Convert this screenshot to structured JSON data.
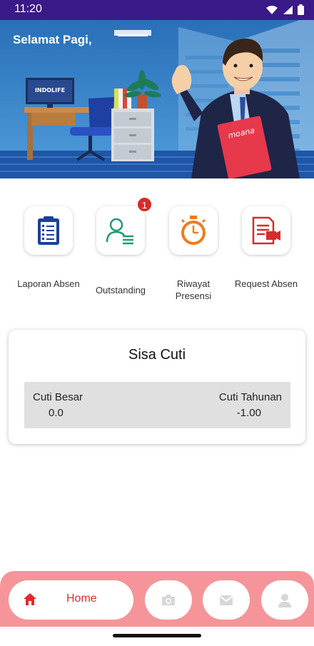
{
  "status_bar": {
    "time": "11:20"
  },
  "hero": {
    "greeting": "Selamat Pagi,",
    "monitor_logo": "INDOLIFE",
    "folder_logo": "moana"
  },
  "menu": {
    "items": [
      {
        "label": "Laporan Absen",
        "icon": "clipboard-checklist-icon",
        "color": "#1d3f9a"
      },
      {
        "label": "Outstanding",
        "icon": "user-list-icon",
        "color": "#1e9a7a",
        "badge": "1"
      },
      {
        "label": "Riwayat Presensi",
        "icon": "stopwatch-icon",
        "color": "#f07b1e"
      },
      {
        "label": "Request Absen",
        "icon": "document-request-icon",
        "color": "#d62b2b"
      }
    ]
  },
  "leave_card": {
    "title": "Sisa Cuti",
    "left_label": "Cuti Besar",
    "left_value": "0.0",
    "right_label": "Cuti Tahunan",
    "right_value": "-1.00"
  },
  "bottom_nav": {
    "home_label": "Home",
    "items": [
      "home-icon",
      "camera-icon",
      "mail-icon",
      "person-icon"
    ],
    "accent": "#e32a2a",
    "bar_color": "#f5959a"
  }
}
